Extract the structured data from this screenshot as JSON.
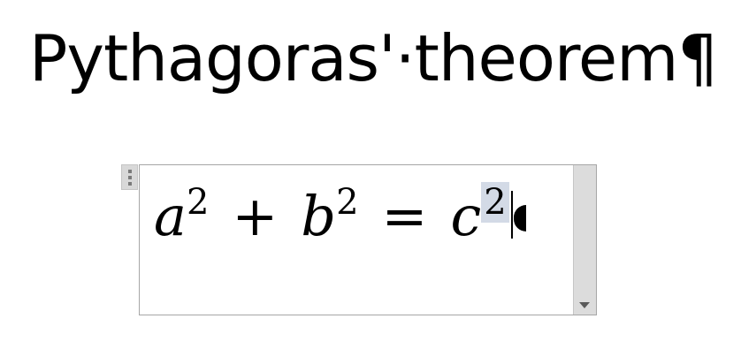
{
  "document": {
    "heading": "Pythagoras'·theorem¶"
  },
  "equation_object": {
    "terms": {
      "a": "a",
      "b": "b",
      "c": "c"
    },
    "exponents": {
      "a": "2",
      "b": "2",
      "c": "2"
    },
    "operators": {
      "plus": "+",
      "equals": "="
    },
    "selected_text": "2",
    "icons": {
      "handle": "drag-handle-icon",
      "scroll_down": "scroll-down-arrow-icon",
      "end_marker": "equation-end-marker-icon"
    }
  }
}
